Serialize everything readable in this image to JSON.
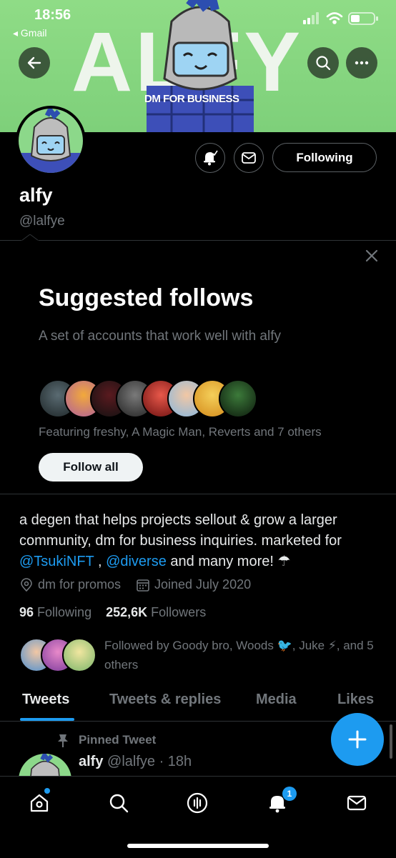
{
  "status": {
    "time": "18:56",
    "back_app": "◂ Gmail"
  },
  "banner": {
    "word": "ALFY",
    "tagline": "DM FOR BUSINESS"
  },
  "header": {
    "back_icon": "arrow-left-icon",
    "search_icon": "search-icon",
    "more_icon": "more-icon"
  },
  "profile": {
    "name": "alfy",
    "handle": "@lalfye",
    "following_button": "Following",
    "bio_part1": "a degen that helps projects sellout & grow a larger community, dm for business inquiries. marketed for ",
    "bio_link1": "@TsukiNFT",
    "bio_sep": " , ",
    "bio_link2": "@diverse",
    "bio_part2": " and many more! ☂",
    "location": "dm for promos",
    "joined": "Joined July 2020",
    "following_count": "96",
    "following_label": "Following",
    "followers_count": "252,6K",
    "followers_label": "Followers",
    "followed_by": "Followed by Goody bro, Woods 🐦, Juke ⚡, and 5 others"
  },
  "suggested": {
    "title": "Suggested follows",
    "subtitle": "A set of accounts that work well with alfy",
    "featuring": "Featuring freshy, A Magic Man, Reverts and 7 others",
    "follow_all": "Follow all"
  },
  "tabs": [
    {
      "label": "Tweets"
    },
    {
      "label": "Tweets & replies"
    },
    {
      "label": "Media"
    },
    {
      "label": "Likes"
    }
  ],
  "tweet": {
    "pinned": "Pinned Tweet",
    "name": "alfy",
    "meta": "@lalfye · 18h"
  },
  "nav": {
    "notifications_badge": "1"
  },
  "colors": {
    "accent": "#1d9bf0",
    "banner_green": "#8fdc86",
    "background": "#000000",
    "muted": "#71767b"
  }
}
